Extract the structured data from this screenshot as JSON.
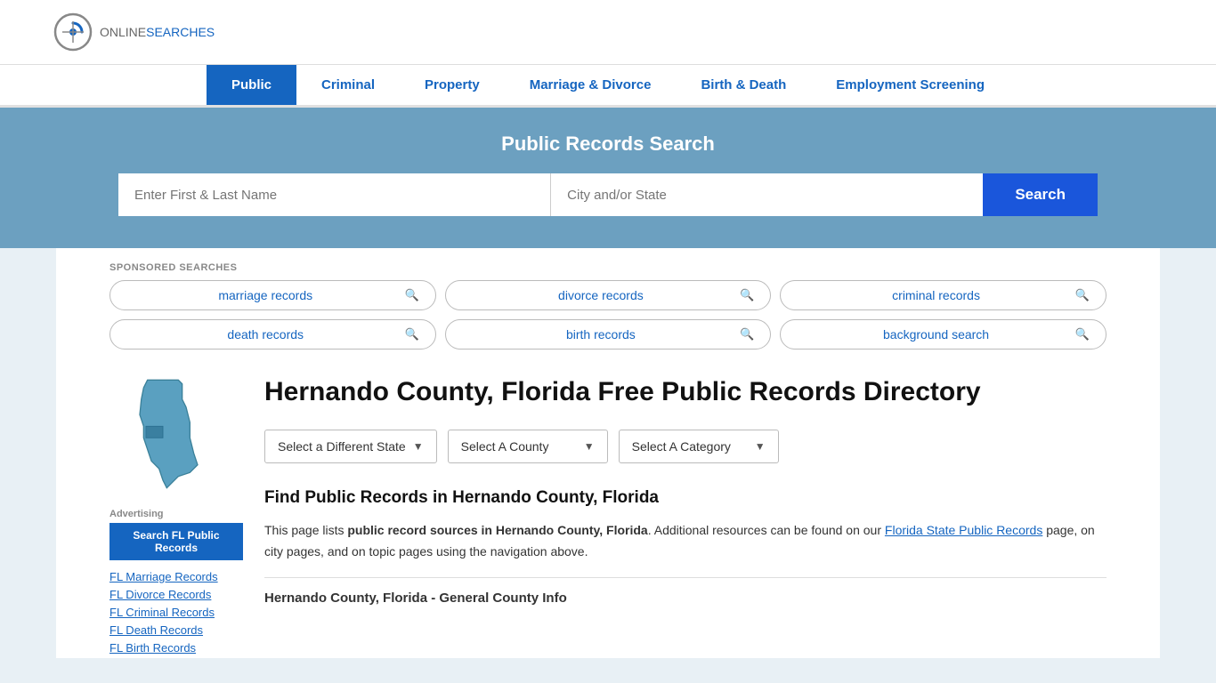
{
  "logo": {
    "online": "ONLINE",
    "searches": "SEARCHES"
  },
  "nav": {
    "items": [
      {
        "label": "Public",
        "active": true
      },
      {
        "label": "Criminal",
        "active": false
      },
      {
        "label": "Property",
        "active": false
      },
      {
        "label": "Marriage & Divorce",
        "active": false
      },
      {
        "label": "Birth & Death",
        "active": false
      },
      {
        "label": "Employment Screening",
        "active": false
      }
    ]
  },
  "hero": {
    "title": "Public Records Search",
    "name_placeholder": "Enter First & Last Name",
    "location_placeholder": "City and/or State",
    "search_label": "Search"
  },
  "sponsored": {
    "label": "SPONSORED SEARCHES",
    "pills": [
      {
        "text": "marriage records"
      },
      {
        "text": "divorce records"
      },
      {
        "text": "criminal records"
      },
      {
        "text": "death records"
      },
      {
        "text": "birth records"
      },
      {
        "text": "background search"
      }
    ]
  },
  "page_title": "Hernando County, Florida Free Public Records Directory",
  "dropdowns": {
    "state": "Select a Different State",
    "county": "Select A County",
    "category": "Select A Category"
  },
  "find_section": {
    "title": "Find Public Records in Hernando County, Florida",
    "description_part1": "This page lists ",
    "description_bold": "public record sources in Hernando County, Florida",
    "description_part2": ". Additional resources can be found on our ",
    "description_link": "Florida State Public Records",
    "description_part3": " page, on city pages, and on topic pages using the navigation above."
  },
  "county_info_title": "Hernando County, Florida - General County Info",
  "sidebar": {
    "advertising_label": "Advertising",
    "ad_button": "Search FL Public Records",
    "links": [
      {
        "text": "FL Marriage Records"
      },
      {
        "text": "FL Divorce Records"
      },
      {
        "text": "FL Criminal Records"
      },
      {
        "text": "FL Death Records"
      },
      {
        "text": "FL Birth Records"
      }
    ]
  }
}
